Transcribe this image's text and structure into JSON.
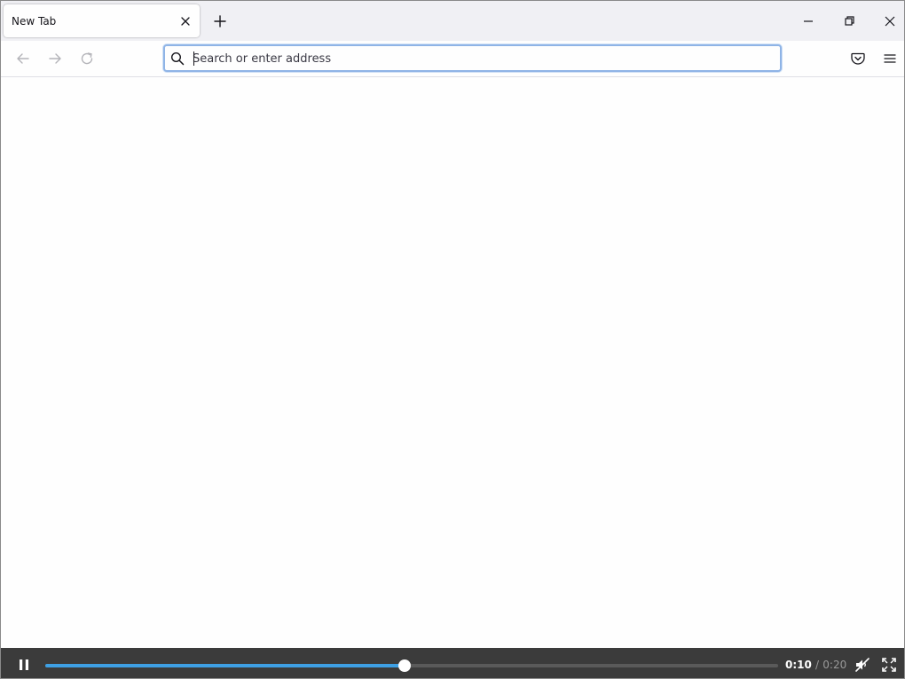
{
  "browser": {
    "tabs": [
      {
        "label": "New Tab",
        "active": true
      }
    ],
    "controls": {
      "close_tab_icon": "close-icon",
      "new_tab_icon": "plus-icon",
      "minimize_icon": "minimize-icon",
      "maximize_icon": "restore-icon",
      "close_window_icon": "close-icon"
    },
    "navbar": {
      "back_icon": "arrow-left-icon",
      "forward_icon": "arrow-right-icon",
      "reload_icon": "reload-icon",
      "search_icon": "search-icon",
      "pocket_icon": "pocket-icon",
      "menu_icon": "hamburger-menu-icon"
    },
    "urlbar": {
      "value": "",
      "placeholder": "Search or enter address"
    }
  },
  "video_controls": {
    "state": "playing",
    "pause_icon": "pause-icon",
    "current_time": "0:10",
    "separator": "/",
    "duration": "0:20",
    "progress": 0.49,
    "mute_icon": "muted-speaker-icon",
    "fullscreen_icon": "fullscreen-icon"
  },
  "colors": {
    "accent": "#3ea0e4",
    "tabstrip_bg": "#f0f0f4",
    "controls_bg": "#3b3b3b",
    "urlbar_focus": "#8fb4e6"
  }
}
